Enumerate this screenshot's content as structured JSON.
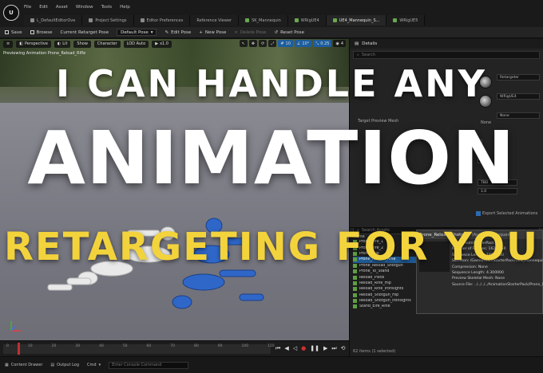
{
  "menu": {
    "items": [
      "File",
      "Edit",
      "Asset",
      "Window",
      "Tools",
      "Help"
    ]
  },
  "tabs": [
    {
      "label": "L_DefaultEditorOve"
    },
    {
      "label": "Project Settings"
    },
    {
      "label": "Editor Preferences"
    },
    {
      "label": "Reference Viewer"
    },
    {
      "label": "SK_Mannequin"
    },
    {
      "label": "WRigUE4"
    },
    {
      "label": "UE4_Mannequin_S..."
    },
    {
      "label": "WRigUE5"
    }
  ],
  "toolbar": {
    "save": "Save",
    "browse": "Browse",
    "current_pose_label": "Current Retarget Pose",
    "pose_value": "Default Pose",
    "edit_pose": "Edit Pose",
    "new_pose": "New Pose",
    "delete_pose": "Delete Pose",
    "reset_pose": "Reset Pose"
  },
  "viewport": {
    "perspective": "Perspective",
    "lit": "Lit",
    "show": "Show",
    "character": "Character",
    "lod": "LOD Auto",
    "speed": "x1.0",
    "grid": "10",
    "angle": "10°",
    "scale": "0.25",
    "cam": "4",
    "title": "Previewing Animation Prone_Reload_Rifle"
  },
  "headline": {
    "line1": "I CAN HANDLE ANY",
    "line2": "ANIMATION",
    "line3": "RETARGETING FOR YOU"
  },
  "details": {
    "title": "Details",
    "search_placeholder": "Search",
    "source_label": "Retargeter",
    "target_label": "WRigUE4",
    "target_preview": "Target Preview Mesh",
    "none": "None",
    "value_a": "TBD",
    "value_b": "1.0",
    "export_label": "Export Selected Animations"
  },
  "browser": {
    "search_placeholder": "Search Assets",
    "name_header": "Name",
    "rows": [
      {
        "name": "Prone_Fire_1",
        "path": ""
      },
      {
        "name": "Prone_Fire_2",
        "path": ""
      },
      {
        "name": "Prone_Idle",
        "path": ""
      },
      {
        "name": "Prone_Reload_Rifle",
        "path": "",
        "selected": true
      },
      {
        "name": "Prone_Reload_Shotgun",
        "path": ""
      },
      {
        "name": "Prone_To_Stand",
        "path": "/All/Game/AnimStarterP"
      },
      {
        "name": "Reload_Pistol",
        "path": "/All/Game/AnimStarterP"
      },
      {
        "name": "Reload_Rifle_Hip",
        "path": "/All/Game/AnimStarterP"
      },
      {
        "name": "Reload_Rifle_Ironsights",
        "path": "/All/Game/AnimStarterP"
      },
      {
        "name": "Reload_Shotgun_Hip",
        "path": "/All/Game/AnimStarterP"
      },
      {
        "name": "Reload_Shotgun_Ironsights",
        "path": "/All/Game/AnimStarterP"
      },
      {
        "name": "Stand_Eire_Rifle",
        "path": "/All/Game/AnimStarterP"
      }
    ],
    "count": "62 items (1 selected)"
  },
  "tooltip": {
    "title": "Prone_Reload_Shotgun",
    "type": "(Animation Sequence)",
    "lines": [
      "Path: /AnimStarterPack",
      "Number of Frames: 162 / 250",
      "Sequence Length: 186 / 300",
      "Skeleton: /Game/AnimStarterPack/UE4_Mannequin/Mesh/UE4",
      "Compression: None",
      "Sequence Length: 4.300000",
      "Preview Skeletal Mesh: None",
      "Source File: ../../../../AnimationStarterPack/Prone_Reload_Shotgu"
    ]
  },
  "timeline": {
    "ticks": [
      "0",
      "10",
      "20",
      "30",
      "40",
      "50",
      "60",
      "70",
      "80",
      "90",
      "100",
      "110"
    ]
  },
  "status": {
    "content_drawer": "Content Drawer",
    "output_log": "Output Log",
    "cmd": "Cmd",
    "cmd_placeholder": "Enter Console Command"
  }
}
